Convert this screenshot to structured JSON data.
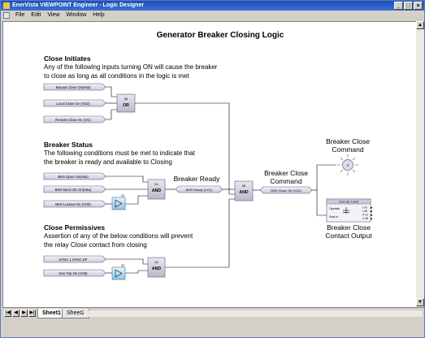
{
  "window": {
    "title": "EnerVista VIEWPOINT Engineer - Logic Designer"
  },
  "menu": [
    "File",
    "Edit",
    "View",
    "Window",
    "Help"
  ],
  "diagram": {
    "title": "Generator Breaker Closing Logic",
    "sections": {
      "close_initiates": {
        "heading": "Close Initiates",
        "desc_line1": "Any of the following inputs turning ON will cause the breaker",
        "desc_line2": "to close as long as all conditions in the logic is met"
      },
      "breaker_status": {
        "heading": "Breaker Status",
        "desc_line1": "The following conditions must be met to indicate that",
        "desc_line2": "the breaker is ready and available to Closing"
      },
      "close_permissives": {
        "heading": "Close Permissives",
        "desc_line1": "Assertion of any of the below conditions will prevent",
        "desc_line2": "the relay Close contact from closing"
      }
    },
    "inputs": {
      "manual_close": "Manual Close On(H5a)",
      "local_close": "Local Close On (VO2)",
      "remote_close": "Remote Close On (VI1)",
      "bkr_open": "BKR Open On(H5a)",
      "bkr_mech_ok": "BKR Mech OK On(H6a)",
      "bkr_lockout": "BKR Lockout On (VO5)",
      "sync1_dpo": "SYNC 1 SYNC DP",
      "gen_trip": "Gen Trip On (VO6)"
    },
    "gates": {
      "or": {
        "num": "36",
        "label": "OR"
      },
      "and1": {
        "num": "24",
        "label": "AND"
      },
      "and2": {
        "num": "38",
        "label": "AND"
      },
      "and3": {
        "num": "35",
        "label": "AND"
      }
    },
    "not_gates": {
      "g1": "22",
      "g2": "32"
    },
    "signals": {
      "bkr_ready_label": "Breaker Ready",
      "bkr_ready": "BKR Ready (VO1)",
      "bkr_close_cmd_label": "Breaker Close",
      "bkr_close_cmd_label2": "Command",
      "bkr_close": "BKR Close Ok (VO2)"
    },
    "outputs": {
      "lamp_title1": "Breaker Close",
      "lamp_title2": "Command",
      "lamp_num": "1",
      "contact_title1": "Breaker Close",
      "contact_title2": "Contact Output",
      "contact_block": {
        "header": "Cont Op 1 (H1)",
        "operate": "Operate",
        "seal_in": "Seal-In",
        "states": [
          "I on",
          "I off",
          "V on",
          "V off"
        ]
      }
    }
  },
  "tabs": [
    "Sheet1",
    "Sheet2"
  ]
}
